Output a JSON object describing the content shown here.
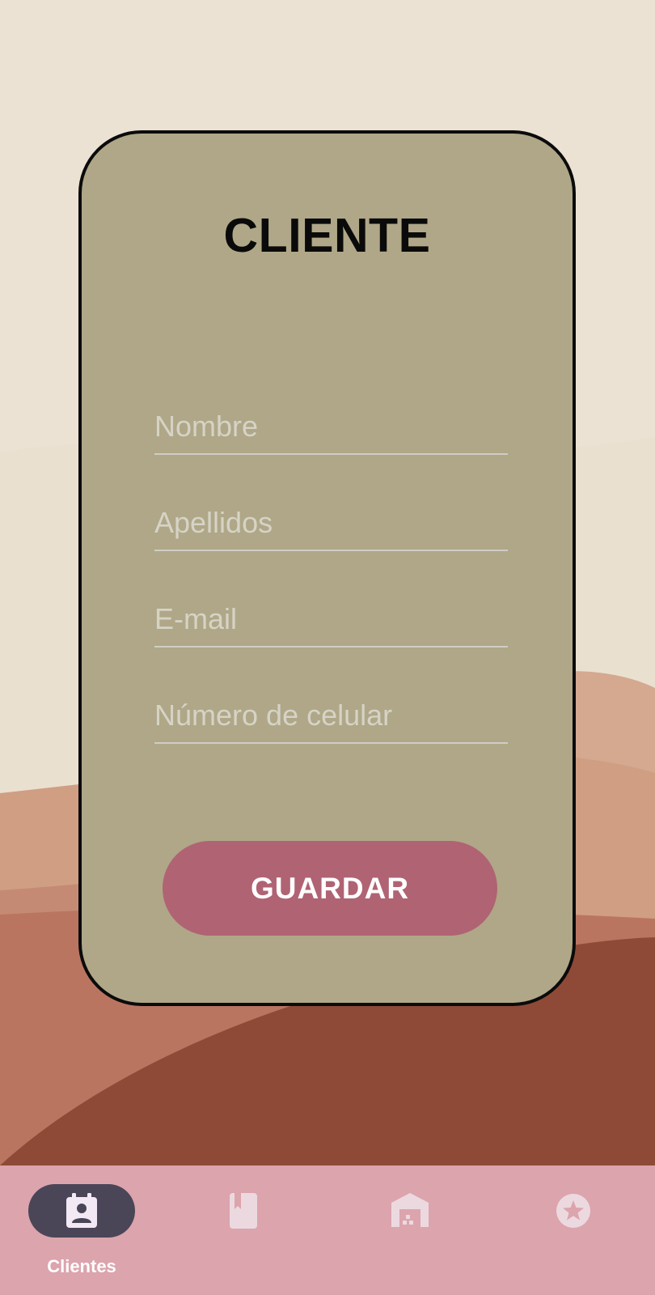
{
  "form": {
    "title": "CLIENTE",
    "fields": {
      "nombre": {
        "placeholder": "Nombre",
        "value": ""
      },
      "apellidos": {
        "placeholder": "Apellidos",
        "value": ""
      },
      "email": {
        "placeholder": "E-mail",
        "value": ""
      },
      "celular": {
        "placeholder": "Número de celular",
        "value": ""
      }
    },
    "save_label": "GUARDAR"
  },
  "bottom_nav": {
    "items": [
      {
        "label": "Clientes",
        "icon": "contact-calendar-icon",
        "active": true
      },
      {
        "label": "",
        "icon": "book-icon",
        "active": false
      },
      {
        "label": "",
        "icon": "warehouse-icon",
        "active": false
      },
      {
        "label": "",
        "icon": "star-circle-icon",
        "active": false
      }
    ]
  },
  "colors": {
    "card": "#afa787",
    "button": "#b06373",
    "nav_bar": "#dca4ad",
    "nav_active_pill": "#4a4658"
  }
}
